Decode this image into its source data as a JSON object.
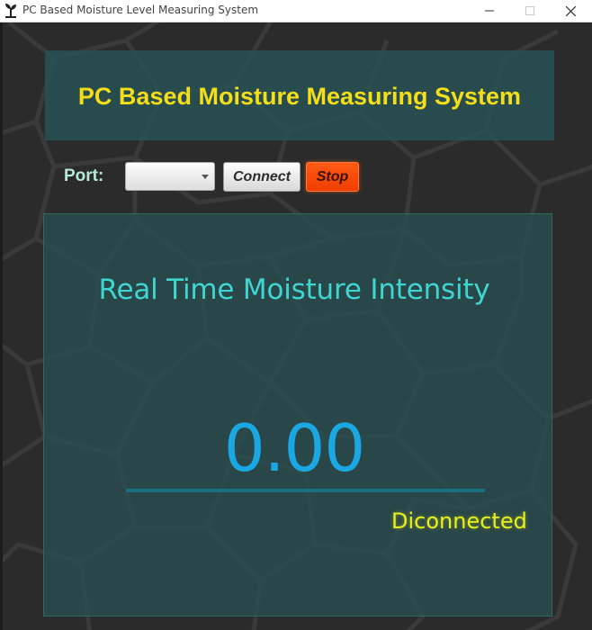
{
  "window": {
    "title": "PC Based Moisture Level Measuring System",
    "icon": "plant-icon",
    "controls": [
      "minimize-icon",
      "maximize-icon",
      "close-icon"
    ]
  },
  "header": {
    "title": "PC Based Moisture Measuring System"
  },
  "controls": {
    "port_label": "Port:",
    "port_value": "",
    "connect_label": "Connect",
    "stop_label": "Stop"
  },
  "main": {
    "heading": "Real Time Moisture Intensity",
    "reading": "0.00",
    "level": 0,
    "status": "Diconnected"
  },
  "colors": {
    "title_yellow": "#f4de19",
    "heading_cyan": "#3fd6d2",
    "reading_blue": "#1ba7e2",
    "status_yellow": "#e6f01a",
    "stop_orange": "#ff4a0a",
    "panel_teal": "#294d50"
  }
}
